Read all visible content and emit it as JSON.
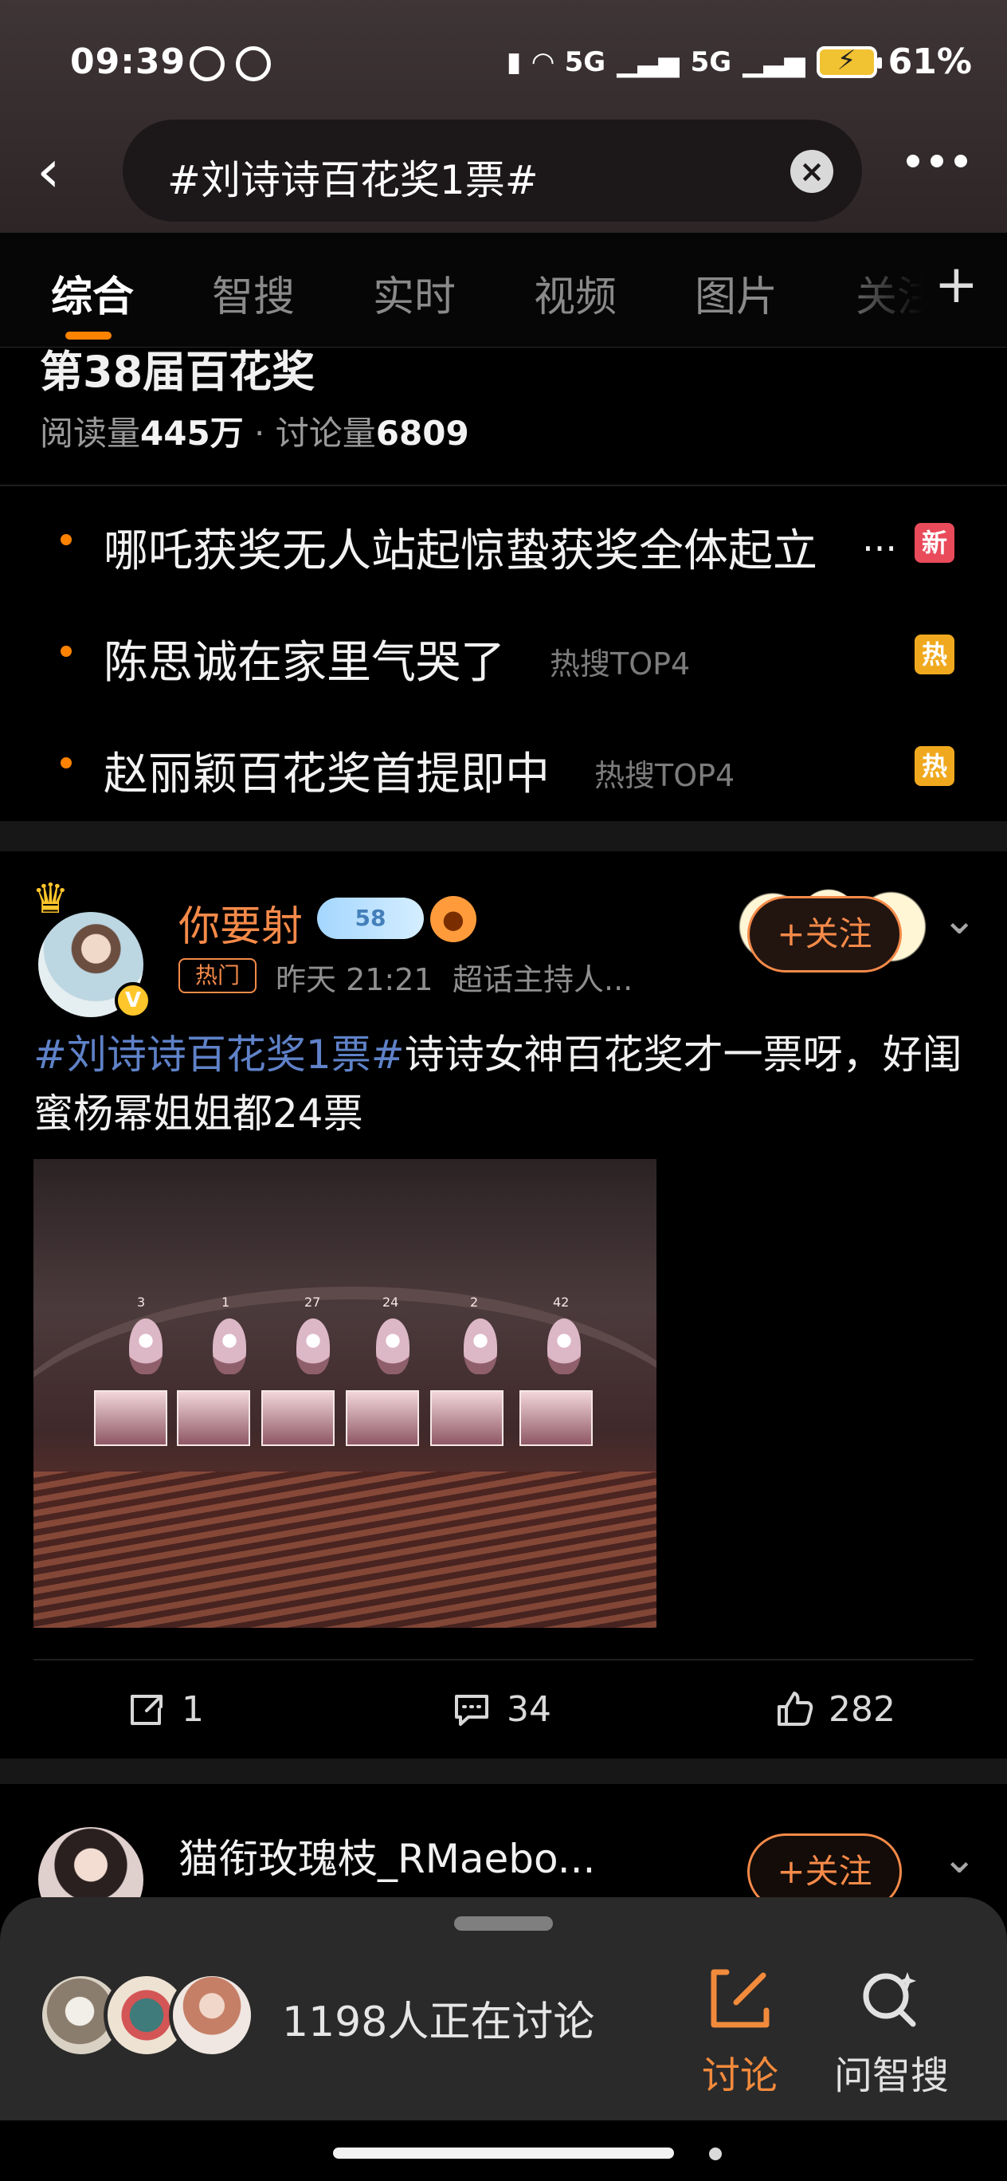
{
  "status_bar": {
    "time": "09:39",
    "battery": "61%",
    "network_1": "5G",
    "network_2": "5G"
  },
  "header": {
    "search_query": "#刘诗诗百花奖1票#",
    "back_icon": "back-arrow-icon",
    "clear_icon": "clear-icon",
    "more_icon": "more-icon"
  },
  "tabs": [
    {
      "label": "综合"
    },
    {
      "label": "智搜"
    },
    {
      "label": "实时"
    },
    {
      "label": "视频"
    },
    {
      "label": "图片"
    },
    {
      "label": "关注"
    }
  ],
  "tab_add": "+",
  "topic": {
    "name": "第38届百花奖",
    "read_label": "阅读量",
    "read_value": "445万",
    "separator": "·",
    "discussion_label": "讨论量",
    "discussion_value": "6809"
  },
  "hot_list": [
    {
      "text": "哪吒获奖无人站起惊蛰获奖全体起立",
      "ellipsis": "...",
      "tag": "",
      "badge": "新",
      "badge_color": "#e94b5b"
    },
    {
      "text": "陈思诚在家里气哭了",
      "tag": "热搜TOP4",
      "badge": "热",
      "badge_color": "#f0a91e"
    },
    {
      "text": "赵丽颖百花奖首提即中",
      "tag": "热搜TOP4",
      "badge": "热",
      "badge_color": "#f0a91e"
    }
  ],
  "post": {
    "username": "你要射",
    "verified_icon": "verified-v-icon",
    "medal_label": "58",
    "hot_label": "热门",
    "time": "昨天 21:21",
    "source": "超话主持人...",
    "follow_label": "+关注",
    "content_hashtag": "#刘诗诗百花奖1票#",
    "content_text": "诗诗女神百花奖才一票呀，好闺蜜杨幂姐姐都24票",
    "image_numbers": [
      "3",
      "1",
      "27",
      "24",
      "2",
      "42"
    ],
    "repost_count": "1",
    "comment_count": "34",
    "like_count": "282"
  },
  "post2": {
    "username": "猫衔玫瑰枝_RMaebo...",
    "follow_label": "+关注"
  },
  "discussion": {
    "count_text": "1198人正在讨论",
    "discuss_label": "讨论",
    "ask_label": "问智搜",
    "accent_color": "#f28a3c"
  }
}
